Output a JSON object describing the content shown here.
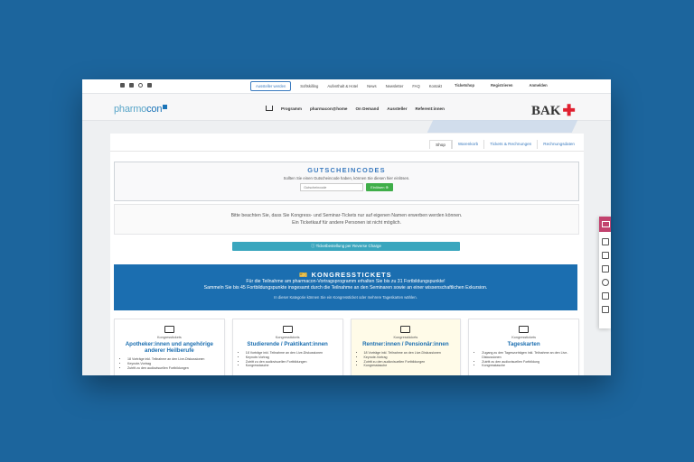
{
  "topbar": {
    "social": [
      "linkedin-icon",
      "facebook-icon",
      "instagram-icon",
      "youtube-icon"
    ],
    "links": [
      "Aussteller werden",
      "Softskilling",
      "Aufenthalt & Hotel",
      "News",
      "Newsletter",
      "FAQ",
      "Kontakt"
    ],
    "ticketshop": "Ticketshop",
    "register": "Registrieren",
    "login": "Anmelden"
  },
  "nav": {
    "logo_a": "pharmo",
    "logo_b": "con",
    "links": [
      "Programm",
      "pharmacon@home",
      "On Demand",
      "Aussteller",
      "Referent:innen"
    ],
    "bak": "BAK"
  },
  "tabs": [
    "Shop",
    "Warenkorb",
    "Tickets & Rechnungen",
    "Rechnungsdaten"
  ],
  "coupon": {
    "title": "GUTSCHEINCODES",
    "text": "Sollten Sie einen Gutscheincode haben, können Sie diesen hier einlösen.",
    "placeholder": "Gutscheincode",
    "button": "Einlösen"
  },
  "notice": {
    "line1": "Bitte beachten Sie, dass Sie Kongress- und Seminar-Tickets nur auf eigenen Namen erwerben werden können.",
    "line2": "Ein Ticketkauf für andere Personen ist nicht möglich."
  },
  "reverse_charge": "Ticketbestellung per Reverse Charge",
  "banner": {
    "title": "KONGRESSTICKETS",
    "line1": "Für die Teilnahme am pharmacon-Vortragsprogramm erhalten Sie bis zu 31 Fortbildungspunkte!",
    "line2": "Sammeln Sie bis 45 Fortbildungspunkte insgesamt durch die Teilnahme an den Seminaren sowie an einer wissenschaftlichen Exkursion.",
    "note": "In dieser Kategorie können Sie ein Kongressticket oder mehrere Tageskarten wählen."
  },
  "cards": [
    {
      "category": "Kongresstickets",
      "title": "Apotheker:innen und angehörige anderer Heilberufe",
      "items": [
        "18 Vorträge inkl. Teilnahme an den Live-Diskussionen",
        "Keynote-Vortrag",
        "Zutritt zu den audiovisuellen Fortbildungen"
      ]
    },
    {
      "category": "Kongresstickets",
      "title": "Studierende / Praktikant:innen",
      "items": [
        "18 Vorträge inkl. Teilnahme an den Live-Diskussionen",
        "Keynote-Vortrag",
        "Zutritt zu den audiovisuellen Fortbildungen",
        "Kongresstasche"
      ]
    },
    {
      "category": "Kongresstickets",
      "title": "Rentner:innen / Pensionär:innen",
      "items": [
        "18 Vorträge inkl. Teilnahme an den Live-Diskussionen",
        "Keynote-Vortrag",
        "Zutritt zu den audiovisuellen Fortbildungen",
        "Kongresstasche"
      ]
    },
    {
      "category": "Kongresstickets",
      "title": "Tageskarten",
      "items": [
        "Zugang zu den Tagesvorträgen inkl. Teilnahme an den Live-Diskussionen",
        "Zutritt zu den audiovisuellen Fortbildung",
        "Kongresstasche"
      ]
    }
  ],
  "float_icons": [
    "ticket-icon",
    "gift-icon",
    "hotel-icon",
    "login-icon",
    "help-icon",
    "book-icon",
    "calendar-icon"
  ]
}
